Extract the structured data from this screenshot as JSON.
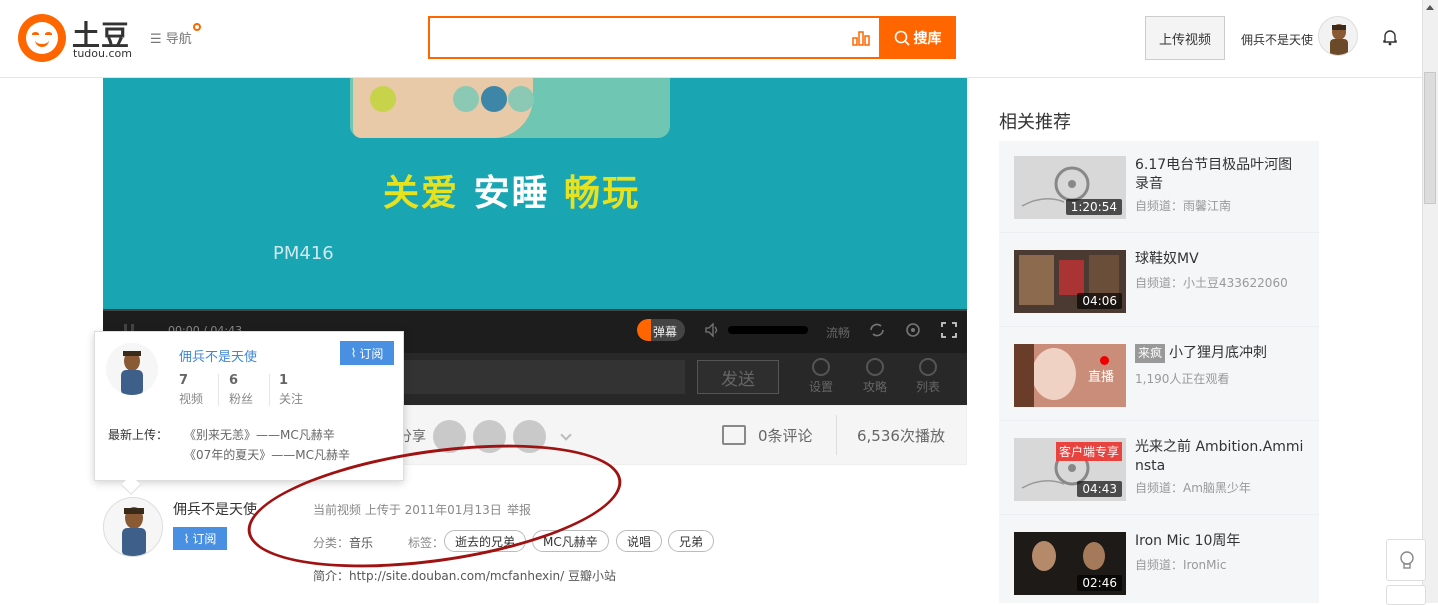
{
  "header": {
    "logo_text": "土豆",
    "logo_domain": "tudou.com",
    "nav_label": "☰ 导航",
    "search_placeholder": "",
    "search_button": "搜库",
    "upload_button": "上传视频",
    "username": "佣兵不是天使"
  },
  "player": {
    "ad_slogan_1": "关爱",
    "ad_slogan_2": "安睡",
    "ad_slogan_3": "畅玩",
    "ad_code": "PM416",
    "time": "00:00 / 04:43",
    "danmu_toggle": "弹幕",
    "quality": "流畅",
    "send_button": "发送",
    "bar_items": [
      "设置",
      "攻略",
      "列表"
    ]
  },
  "stats": {
    "share_label": "分享",
    "comments": "0条评论",
    "plays": "6,536次播放"
  },
  "popover": {
    "name": "佣兵不是天使",
    "subscribe": "订阅",
    "stats": [
      {
        "num": "7",
        "label": "视频"
      },
      {
        "num": "6",
        "label": "粉丝"
      },
      {
        "num": "1",
        "label": "关注"
      }
    ],
    "latest_label": "最新上传：",
    "latest": [
      "《别来无恙》——MC凡赫辛",
      "《07年的夏天》——MC凡赫辛"
    ]
  },
  "uploader": {
    "name": "佣兵不是天使",
    "subscribe": "订阅",
    "upload_info": "当前视频 上传于 2011年01月13日",
    "report": "举报",
    "category_label": "分类：",
    "category_value": "音乐",
    "tags_label": "标签：",
    "tags": [
      "逝去的兄弟",
      "MC凡赫辛",
      "说唱",
      "兄弟"
    ],
    "intro": "简介：http://site.douban.com/mcfanhexin/ 豆瓣小站"
  },
  "related": {
    "title": "相关推荐",
    "items": [
      {
        "title": "6.17电台节目极品叶河图录音",
        "channel": "自频道：雨馨江南",
        "duration": "1:20:54"
      },
      {
        "title": "球鞋奴MV",
        "channel": "自频道：小土豆433622060",
        "duration": "04:06"
      },
      {
        "badge": "来疯",
        "title": "小了狸月底冲刺",
        "channel": "1,190人正在观看",
        "live": "直播"
      },
      {
        "title": "光来之前 Ambition.Amminsta",
        "channel": "自频道：Am脑黑少年",
        "duration": "04:43",
        "thumb_badge": "客户端专享"
      },
      {
        "title": "Iron Mic 10周年",
        "channel": "自频道：IronMic",
        "duration": "02:46"
      }
    ]
  },
  "colors": {
    "accent": "#ff6600",
    "link": "#3f86d6",
    "subscribe": "#4a90e2",
    "annotation": "#a01212"
  }
}
